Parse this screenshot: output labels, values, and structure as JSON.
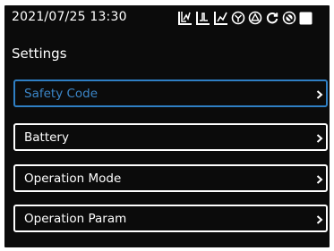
{
  "status_bar": {
    "datetime": "2021/07/25 13:30",
    "icons": [
      "pv-curve-icon",
      "grid-curve-icon",
      "load-curve-icon",
      "fan-circle-icon",
      "warning-circle-icon",
      "refresh-icon",
      "no-entry-icon",
      "square-icon"
    ]
  },
  "page": {
    "title": "Settings"
  },
  "menu": {
    "items": [
      {
        "label": "Safety Code",
        "active": true
      },
      {
        "label": "Battery",
        "active": false
      },
      {
        "label": "Operation Mode",
        "active": false
      },
      {
        "label": "Operation Param",
        "active": false
      }
    ]
  },
  "colors": {
    "background": "#0b0b0b",
    "text": "#ffffff",
    "accent": "#2f7fc4",
    "accent_text": "#3b86c8"
  }
}
